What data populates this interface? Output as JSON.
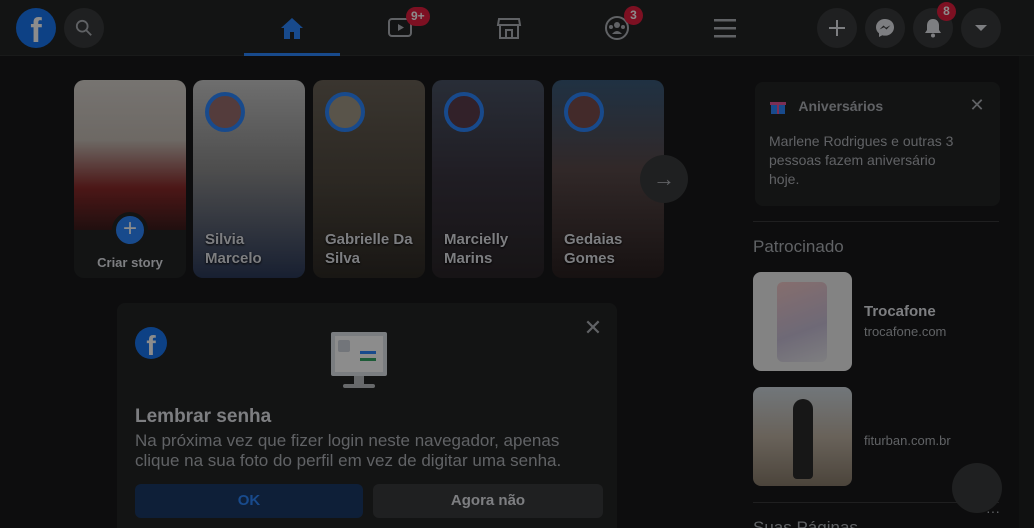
{
  "app": {
    "name": "Facebook"
  },
  "topbar": {
    "logo_letter": "f",
    "badges": {
      "watch": "9+",
      "groups": "3",
      "notifications": "8"
    },
    "nav": [
      "home",
      "watch",
      "marketplace",
      "groups",
      "menu"
    ]
  },
  "stories": {
    "create_label": "Criar story",
    "create_plus": "+",
    "items": [
      {
        "name": "Silvia Marcelo"
      },
      {
        "name": "Gabrielle Da Silva"
      },
      {
        "name": "Marcielly Marins"
      },
      {
        "name": "Gedaias Gomes"
      }
    ],
    "next_arrow": "→"
  },
  "dialog": {
    "logo_letter": "f",
    "close": "✕",
    "title": "Lembrar senha",
    "text": "Na próxima vez que fizer login neste navegador, apenas clique na sua foto do perfil em vez de digitar uma senha.",
    "ok_label": "OK",
    "cancel_label": "Agora não"
  },
  "birthdays": {
    "title": "Aniversários",
    "close": "✕",
    "text": "Marlene Rodrigues e outras 3 pessoas fazem aniversário hoje."
  },
  "sponsored": {
    "title": "Patrocinado",
    "ads": [
      {
        "title": "Trocafone",
        "url": "trocafone.com"
      },
      {
        "title": "",
        "url": "fiturban.com.br"
      }
    ]
  },
  "pages": {
    "title": "Suas Páginas",
    "more": "···"
  },
  "colors": {
    "accent": "#2d88ff",
    "background": "#18191a",
    "surface": "#242526",
    "badge": "#e41e3f"
  }
}
